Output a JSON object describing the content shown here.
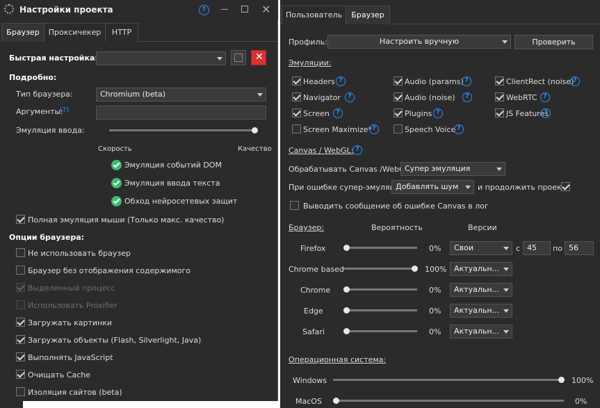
{
  "left": {
    "title": "Настройки проекта",
    "tabs": [
      "Браузер",
      "Проксичекер",
      "HTTP"
    ],
    "quick_label": "Быстрая настройка:",
    "detail_label": "Подробно:",
    "browser_type_label": "Тип браузера:",
    "browser_type_value": "Chromium (beta)",
    "args_label": "Аргументы:",
    "input_emul_label": "Эмуляция ввода:",
    "slider_min": "Скорость",
    "slider_max": "Качество",
    "emul_items": [
      "Эмуляция событий DOM",
      "Эмуляция ввода текста",
      "Обход нейросетевых защит"
    ],
    "mouse_full": "Полная эмуляция мыши (Только макс. качество)",
    "options_label": "Опции браузера:",
    "options": [
      {
        "label": "Не использовать браузер",
        "checked": false,
        "disabled": false
      },
      {
        "label": "Браузер без отображения содержимого",
        "checked": false,
        "disabled": false
      },
      {
        "label": "Выделенный процесс",
        "checked": true,
        "disabled": true
      },
      {
        "label": "Использовать Proxifier",
        "checked": false,
        "disabled": true
      },
      {
        "label": "Загружать картинки",
        "checked": true,
        "disabled": false
      },
      {
        "label": "Загружать объекты (Flash, Silverlight, Java)",
        "checked": true,
        "disabled": false
      },
      {
        "label": "Выполнять JavaScript",
        "checked": true,
        "disabled": false
      },
      {
        "label": "Очищать Cache",
        "checked": true,
        "disabled": false
      },
      {
        "label": "Изоляция сайтов (beta)",
        "checked": false,
        "disabled": false
      }
    ]
  },
  "right": {
    "tabs": [
      "Пользователь",
      "Браузер"
    ],
    "profile_label": "Профиль:",
    "profile_value": "Настроить вручную",
    "check_button": "Проверить",
    "emulations_label": "Эмуляции:",
    "emulations": [
      {
        "label": "Headers",
        "checked": true
      },
      {
        "label": "Audio (params)",
        "checked": true
      },
      {
        "label": "ClientRect (noise)",
        "checked": true
      },
      {
        "label": "Navigator",
        "checked": true
      },
      {
        "label": "Audio (noise)",
        "checked": true
      },
      {
        "label": "WebRTC",
        "checked": true
      },
      {
        "label": "Screen",
        "checked": true
      },
      {
        "label": "Plugins",
        "checked": true
      },
      {
        "label": "JS Features",
        "checked": true
      },
      {
        "label": "Screen Maximize*",
        "checked": false
      },
      {
        "label": "Speech Voice",
        "checked": false
      }
    ],
    "canvas_label": "Canvas / WebGL:",
    "canvas_process_label": "Обрабатывать Canvas /WebGL",
    "canvas_process_value": "Супер эмуляция",
    "canvas_error_label": "При ошибке супер-эмуляции",
    "canvas_error_value": "Добавлять шум",
    "canvas_continue_label": "и продолжить проект",
    "canvas_log_label": "Выводить сообщение об ошибке Canvas в лог",
    "browser_label": "Браузер:",
    "prob_header": "Вероятность",
    "versions_header": "Версии",
    "browsers": [
      {
        "name": "Firefox",
        "prob": 0,
        "prob_text": "0%",
        "version": "Свои",
        "from_label": "с",
        "from": "45",
        "to_label": "по",
        "to": "56"
      },
      {
        "name": "Chrome based",
        "prob": 100,
        "prob_text": "100%",
        "version": "Актуальн..."
      },
      {
        "name": "Chrome",
        "prob": 0,
        "prob_text": "0%",
        "version": "Актуальн..."
      },
      {
        "name": "Edge",
        "prob": 0,
        "prob_text": "0%",
        "version": "Актуальн..."
      },
      {
        "name": "Safari",
        "prob": 0,
        "prob_text": "0%",
        "version": "Актуальн..."
      }
    ],
    "os_label": "Операционная система:",
    "os": [
      {
        "name": "Windows",
        "prob": 100,
        "prob_text": "100%"
      },
      {
        "name": "MacOS",
        "prob": 0,
        "prob_text": "0%"
      }
    ]
  }
}
